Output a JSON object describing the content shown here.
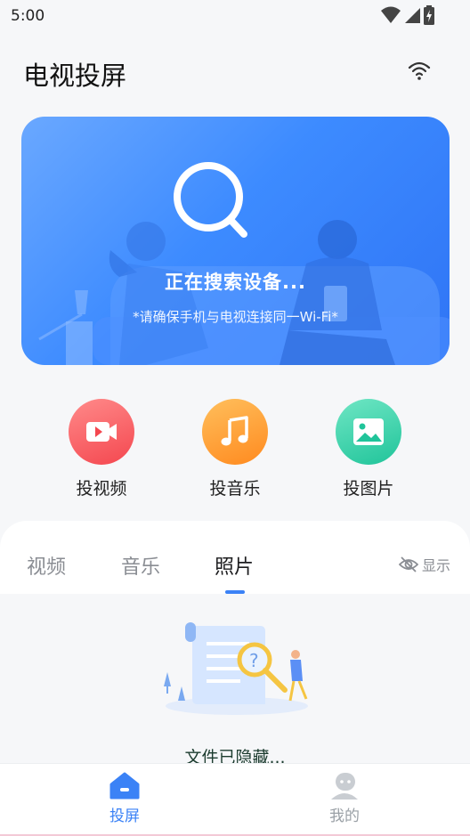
{
  "status_bar": {
    "time": "5:00",
    "icons": [
      "wifi-icon",
      "signal-icon",
      "battery-icon"
    ]
  },
  "header": {
    "title": "电视投屏",
    "action_icon": "wifi-icon"
  },
  "banner": {
    "status": "正在搜索设备...",
    "hint": "*请确保手机与电视连接同一Wi-Fi*",
    "icon": "search-icon",
    "colors": {
      "start": "#6aa8ff",
      "end": "#2f74f5"
    }
  },
  "quick_actions": [
    {
      "label": "投视频",
      "icon": "video-icon",
      "color": "#f4474f"
    },
    {
      "label": "投音乐",
      "icon": "music-note-icon",
      "color": "#ff8a1f"
    },
    {
      "label": "投图片",
      "icon": "image-icon",
      "color": "#20c49a"
    }
  ],
  "tabs": {
    "items": [
      "视频",
      "音乐",
      "照片"
    ],
    "active": "照片",
    "toggle_label": "显示",
    "toggle_icon": "eye-off-icon"
  },
  "empty_state": {
    "text": "文件已隐藏..."
  },
  "bottom_nav": {
    "items": [
      {
        "label": "投屏",
        "icon": "home-icon",
        "active": true
      },
      {
        "label": "我的",
        "icon": "user-icon",
        "active": false
      }
    ],
    "accent": "#3b82f6"
  }
}
